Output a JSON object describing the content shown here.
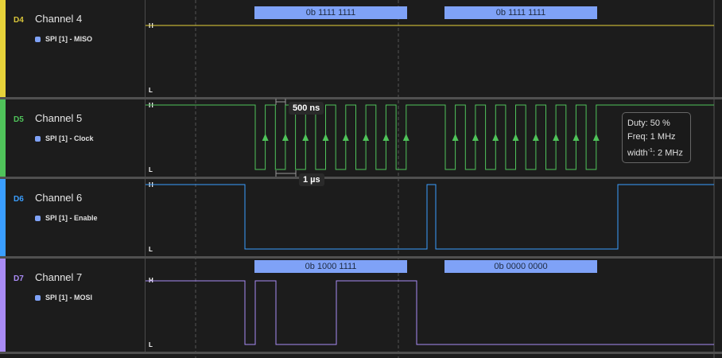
{
  "channels": [
    {
      "id": "D4",
      "name": "Channel 4",
      "analyzer": "SPI [1] - MISO",
      "color": "#e6d23a"
    },
    {
      "id": "D5",
      "name": "Channel 5",
      "analyzer": "SPI [1] - Clock",
      "color": "#4fc35a"
    },
    {
      "id": "D6",
      "name": "Channel 6",
      "analyzer": "SPI [1] - Enable",
      "color": "#3a9eff"
    },
    {
      "id": "D7",
      "name": "Channel 7",
      "analyzer": "SPI [1] - MOSI",
      "color": "#a98bf5"
    }
  ],
  "level_high": "H",
  "level_low": "L",
  "miso_bytes": [
    "0b 1111 1111",
    "0b 1111 1111"
  ],
  "mosi_bytes": [
    "0b 1000 1111",
    "0b 0000 0000"
  ],
  "measure": {
    "half_period": "500 ns",
    "period": "1 µs"
  },
  "tooltip": {
    "duty": "Duty: 50 %",
    "freq": "Freq: 1 MHz",
    "width_pre": "width",
    "width_sup": "-1",
    "width_post": ": 2 MHz"
  }
}
